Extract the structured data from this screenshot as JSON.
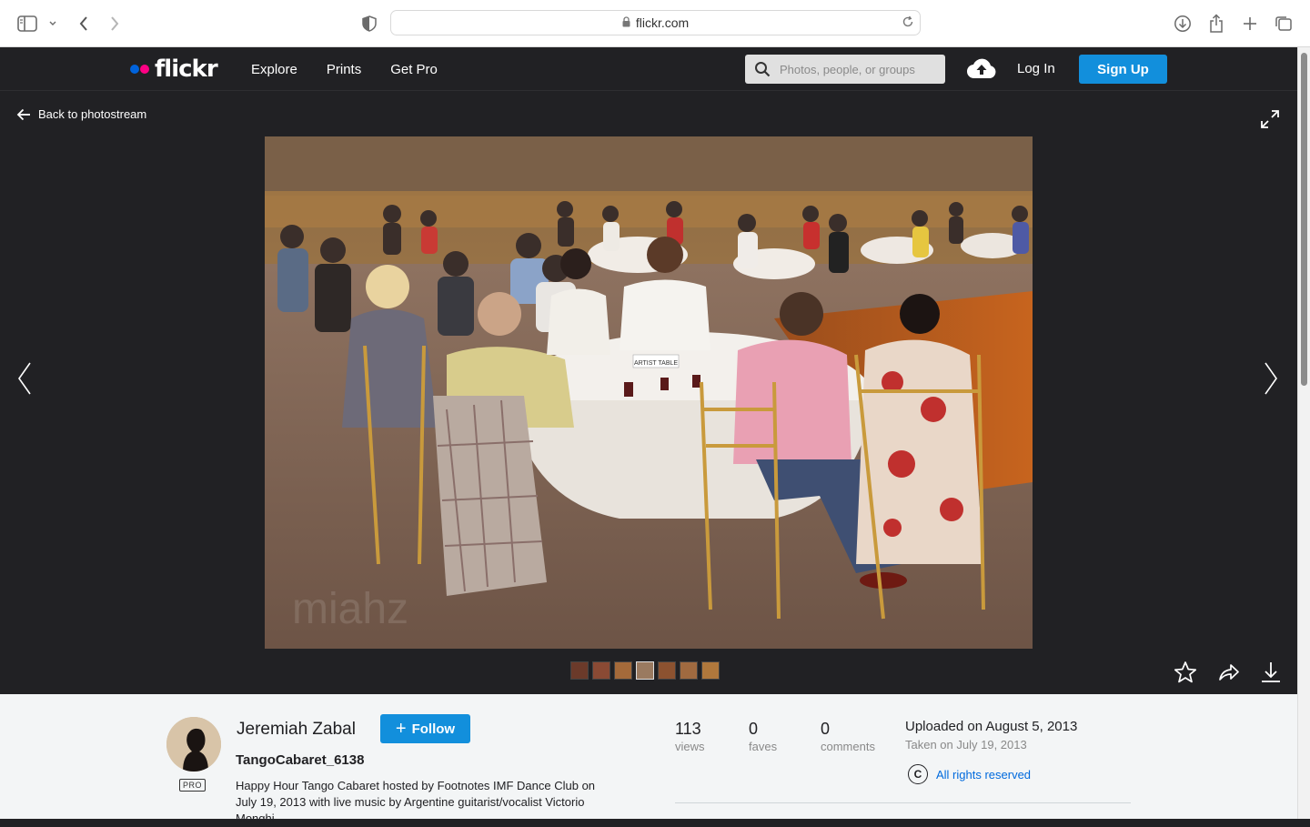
{
  "browser": {
    "url": "flickr.com"
  },
  "nav": {
    "logo": "flickr",
    "links": [
      "Explore",
      "Prints",
      "Get Pro"
    ],
    "search_placeholder": "Photos, people, or groups",
    "login": "Log In",
    "signup": "Sign Up",
    "colors": {
      "blue_dot": "#0063dc",
      "pink_dot": "#ff0084",
      "accent": "#128fdc"
    }
  },
  "viewer": {
    "back_label": "Back to photostream",
    "watermark": "miahz",
    "thumbnail_count": 7,
    "active_thumbnail": 4,
    "placard": "ARTIST TABLE"
  },
  "info": {
    "owner_name": "Jeremiah Zabal",
    "follow_label": "Follow",
    "pro_badge": "PRO",
    "photo_title": "TangoCabaret_6138",
    "description": "Happy Hour Tango Cabaret hosted by Footnotes IMF Dance Club on July 19, 2013 with live music by Argentine guitarist/vocalist Victorio Monghi",
    "stats": [
      {
        "value": "113",
        "label": "views"
      },
      {
        "value": "0",
        "label": "faves"
      },
      {
        "value": "0",
        "label": "comments"
      }
    ],
    "uploaded": "Uploaded on August 5, 2013",
    "taken": "Taken on July 19, 2013",
    "rights": "All rights reserved"
  }
}
